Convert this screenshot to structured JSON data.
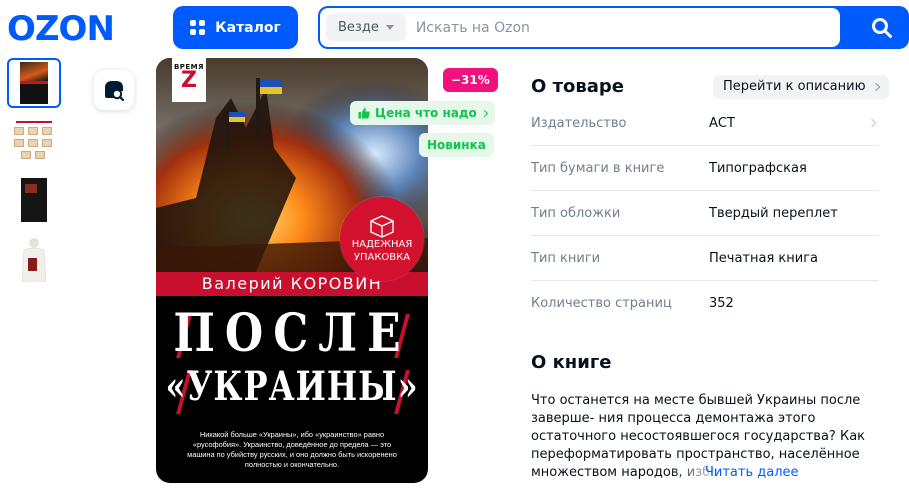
{
  "header": {
    "logo_text": "OZON",
    "catalog_label": "Каталог",
    "search_scope": "Везде",
    "search_placeholder": "Искать на Ozon",
    "brand_color": "#005bff"
  },
  "gallery": {
    "thumbnails": [
      {
        "name": "cover",
        "active": true
      },
      {
        "name": "packaging",
        "active": false
      },
      {
        "name": "back-cover",
        "active": false
      },
      {
        "name": "in-hand",
        "active": false
      }
    ]
  },
  "cover": {
    "series_small": "ВРЕМЯ",
    "series_big": "Z",
    "author": "Валерий КОРОВИН",
    "title_line1": "ПОСЛЕ",
    "title_line2": "«УКРАИНЫ»",
    "blurb": "Никакой больше «Украины», ибо «украинство» равно «русофобия». Украинство, доведённое до предела — это машина по убийству русских, и оно должно быть искоренено полностью и окончательно.",
    "pack_badge_line1": "НАДЕЖНАЯ",
    "pack_badge_line2": "УПАКОВКА"
  },
  "badges": {
    "discount": "−31%",
    "price_good": "Цена что надо",
    "new": "Новинка"
  },
  "about": {
    "title": "О товаре",
    "to_description": "Перейти к описанию",
    "specs": [
      {
        "label": "Издательство",
        "value": "АСТ"
      },
      {
        "label": "Тип бумаги в книге",
        "value": "Типографская"
      },
      {
        "label": "Тип обложки",
        "value": "Твердый переплет"
      },
      {
        "label": "Тип книги",
        "value": "Печатная книга"
      },
      {
        "label": "Количество страниц",
        "value": "352"
      }
    ]
  },
  "book": {
    "title": "О книге",
    "description": "Что останется на месте бывшей Украины после заверше- ния процесса демонтажа этого остаточного несостоявшегося государства? Как переформатировать пространство, населённое множеством народов, избе",
    "read_more": "Читать далее"
  }
}
